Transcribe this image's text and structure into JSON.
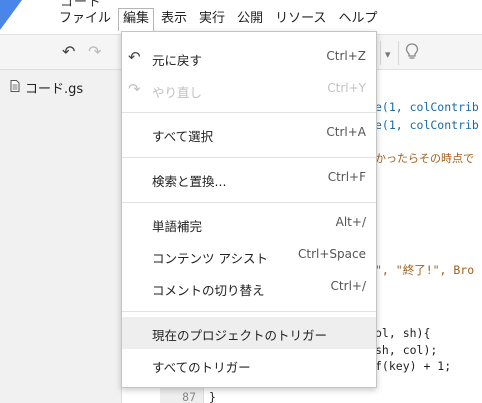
{
  "title_fragment": "コード",
  "menubar": {
    "items": [
      {
        "label": "ファイル"
      },
      {
        "label": "編集"
      },
      {
        "label": "表示"
      },
      {
        "label": "実行"
      },
      {
        "label": "公開"
      },
      {
        "label": "リソース"
      },
      {
        "label": "ヘルプ"
      }
    ]
  },
  "files": [
    {
      "name": "コード.gs"
    }
  ],
  "code": {
    "line_number": "87",
    "lines": [
      "e(1, colContrib",
      "e(1, colContrib",
      "かったらその時点で",
      "\", \"終了!\", Bro",
      "ol, sh){",
      "sh, col);",
      "f(key) + 1;",
      "}"
    ]
  },
  "edit_menu": {
    "items": [
      {
        "label": "元に戻す",
        "shortcut": "Ctrl+Z",
        "icon": "undo-icon",
        "glyph": "↶",
        "enabled": true
      },
      {
        "label": "やり直し",
        "shortcut": "Ctrl+Y",
        "icon": "redo-icon",
        "glyph": "↷",
        "enabled": false
      },
      {
        "label": "すべて選択",
        "shortcut": "Ctrl+A",
        "enabled": true
      },
      {
        "label": "検索と置換...",
        "shortcut": "Ctrl+F",
        "enabled": true
      },
      {
        "label": "単語補完",
        "shortcut": "Alt+/",
        "enabled": true
      },
      {
        "label": "コンテンツ アシスト",
        "shortcut": "Ctrl+Space",
        "enabled": true
      },
      {
        "label": "コメントの切り替え",
        "shortcut": "Ctrl+/",
        "enabled": true
      },
      {
        "label": "現在のプロジェクトのトリガー",
        "shortcut": "",
        "enabled": true,
        "highlighted": true
      },
      {
        "label": "すべてのトリガー",
        "shortcut": "",
        "enabled": true
      }
    ]
  },
  "colors": {
    "accent": "#4a86e8",
    "code_blue": "#1a6aa8",
    "code_string": "#a35e16",
    "menu_highlight": "#eeeeee"
  }
}
